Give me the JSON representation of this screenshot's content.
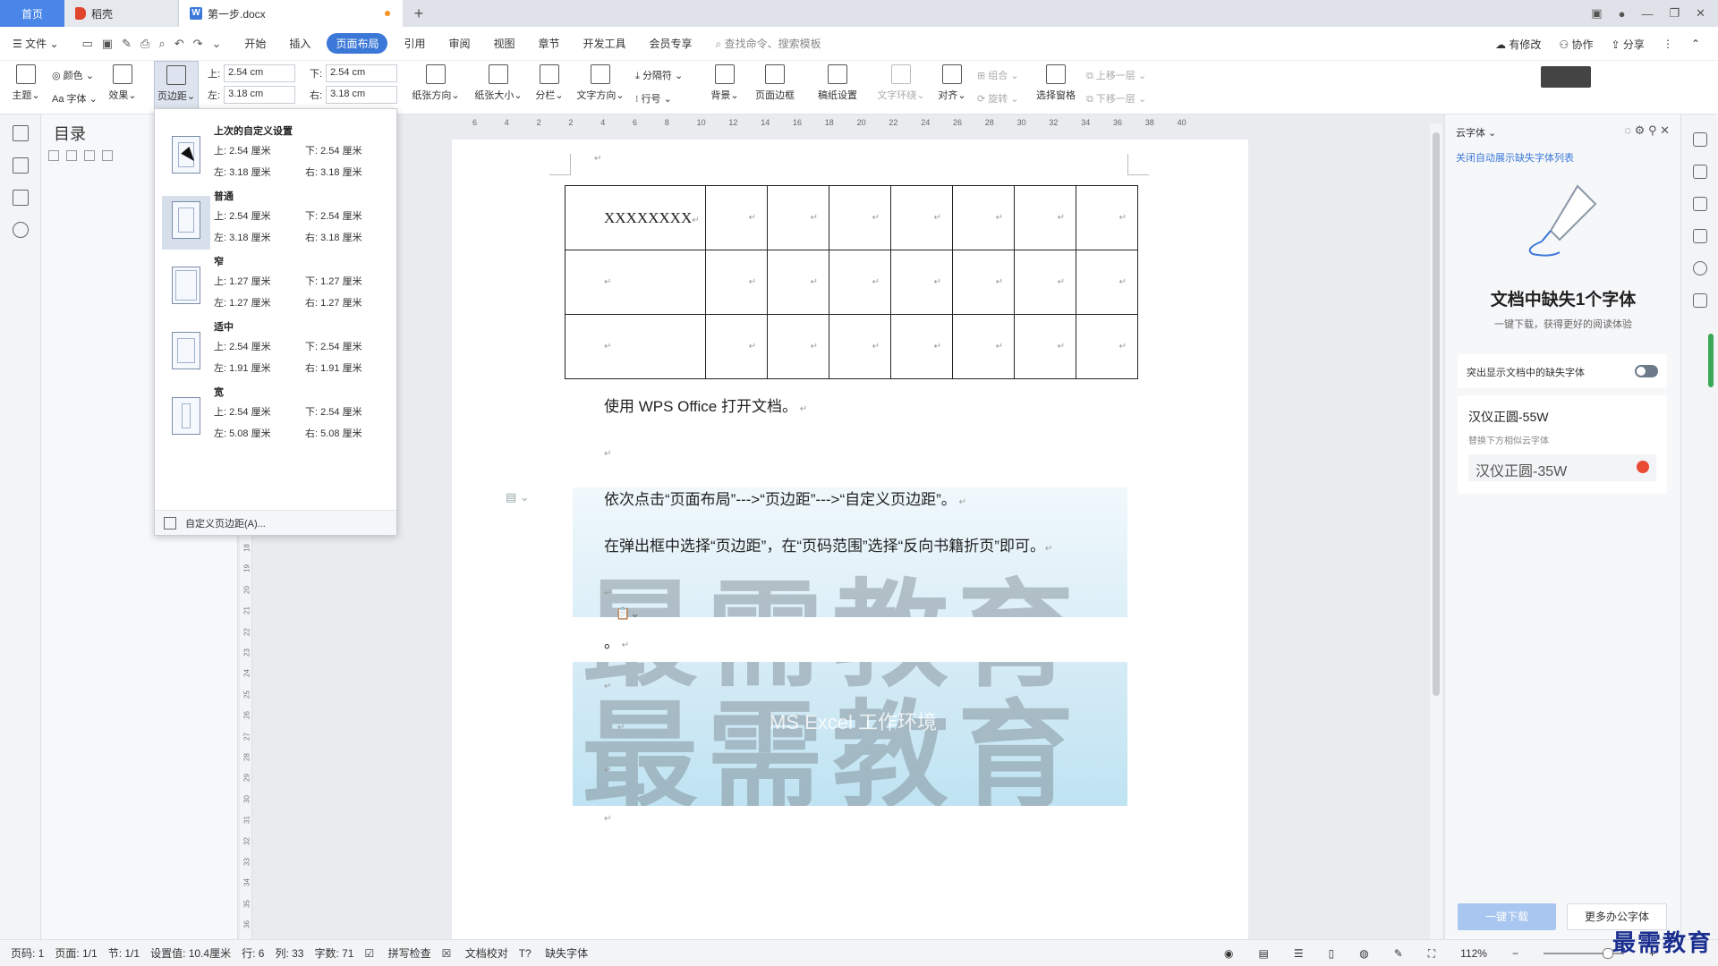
{
  "titlebar": {
    "tabs": [
      {
        "label": "首页"
      },
      {
        "label": "稻壳"
      },
      {
        "label": "第一步.docx"
      }
    ],
    "add": "+"
  },
  "menubar": {
    "file": "文件",
    "items": [
      "开始",
      "插入",
      "页面布局",
      "引用",
      "审阅",
      "视图",
      "章节",
      "开发工具",
      "会员专享"
    ],
    "active": "页面布局",
    "search": "查找命令、搜索模板",
    "right": [
      "有修改",
      "协作",
      "分享"
    ]
  },
  "ribbon": {
    "theme": "主题",
    "color": "颜色",
    "font": "字体",
    "effect": "效果",
    "margins": "页边距",
    "top_label": "上:",
    "top_value": "2.54 cm",
    "bottom_label": "下:",
    "bottom_value": "2.54 cm",
    "left_label": "左:",
    "left_value": "3.18 cm",
    "right_label": "右:",
    "right_value": "3.18 cm",
    "orientation": "纸张方向",
    "size": "纸张大小",
    "columns": "分栏",
    "text_dir": "文字方向",
    "separator": "分隔符",
    "line_no": "行号",
    "background": "背景",
    "border": "页面边框",
    "grid": "稿纸设置",
    "wrap": "文字环绕",
    "align": "对齐",
    "group": "组合",
    "rotate": "旋转",
    "select_pane": "选择窗格",
    "up": "上移一层",
    "down": "下移一层"
  },
  "toc": {
    "title": "目录"
  },
  "dropdown": {
    "items": [
      {
        "name": "上次的自定义设置",
        "top": "上: 2.54 厘米",
        "bottom": "下: 2.54 厘米",
        "left": "左: 3.18 厘米",
        "right": "右: 3.18 厘米"
      },
      {
        "name": "普通",
        "top": "上: 2.54 厘米",
        "bottom": "下: 2.54 厘米",
        "left": "左: 3.18 厘米",
        "right": "右: 3.18 厘米"
      },
      {
        "name": "窄",
        "top": "上: 1.27 厘米",
        "bottom": "下: 1.27 厘米",
        "left": "左: 1.27 厘米",
        "right": "右: 1.27 厘米"
      },
      {
        "name": "适中",
        "top": "上: 2.54 厘米",
        "bottom": "下: 2.54 厘米",
        "left": "左: 1.91 厘米",
        "right": "右: 1.91 厘米"
      },
      {
        "name": "宽",
        "top": "上: 2.54 厘米",
        "bottom": "下: 2.54 厘米",
        "left": "左: 5.08 厘米",
        "right": "右: 5.08 厘米"
      }
    ],
    "custom": "自定义页边距(A)..."
  },
  "document": {
    "cell": "XXXXXXXX",
    "p1": "使用 WPS Office 打开文档。",
    "p2": "依次点击“页面布局”--->“页边距”--->“自定义页边距”。",
    "p3": "在弹出框中选择“页边距”，在“页码范围”选择“反向书籍折页”即可。",
    "p4": "。",
    "watermark1": "最需教育",
    "watermark2": "最需教育",
    "image_caption": "MS Excel 工作环境"
  },
  "vruler": [
    "18",
    "19",
    "20",
    "21",
    "22",
    "23",
    "24",
    "25",
    "26",
    "27",
    "28",
    "29",
    "30",
    "31",
    "32",
    "33",
    "34",
    "35",
    "36"
  ],
  "hruler": [
    "6",
    "4",
    "2",
    "2",
    "4",
    "6",
    "8",
    "10",
    "12",
    "14",
    "16",
    "18",
    "20",
    "22",
    "24",
    "26",
    "28",
    "30",
    "32",
    "34",
    "36",
    "38",
    "40"
  ],
  "fontpanel": {
    "header": "云字体",
    "link": "关闭自动展示缺失字体列表",
    "headline": "文档中缺失1个字体",
    "sub": "一键下载，获得更好的阅读体验",
    "toggle_label": "突出显示文档中的缺失字体",
    "font_name": "汉仪正圆-55W",
    "font_sub": "替换下方相似云字体",
    "font_replace": "汉仪正圆-35W",
    "btn_download": "一键下载",
    "btn_more": "更多办公字体"
  },
  "status": {
    "page_code": "页码: 1",
    "pages": "页面: 1/1",
    "section": "节: 1/1",
    "setting": "设置值: 10.4厘米",
    "row": "行: 6",
    "col": "列: 33",
    "words": "字数: 71",
    "spell": "拼写检查",
    "proof": "文档校对",
    "missing_font": "缺失字体",
    "zoom": "112%"
  },
  "brand": "最需教育"
}
